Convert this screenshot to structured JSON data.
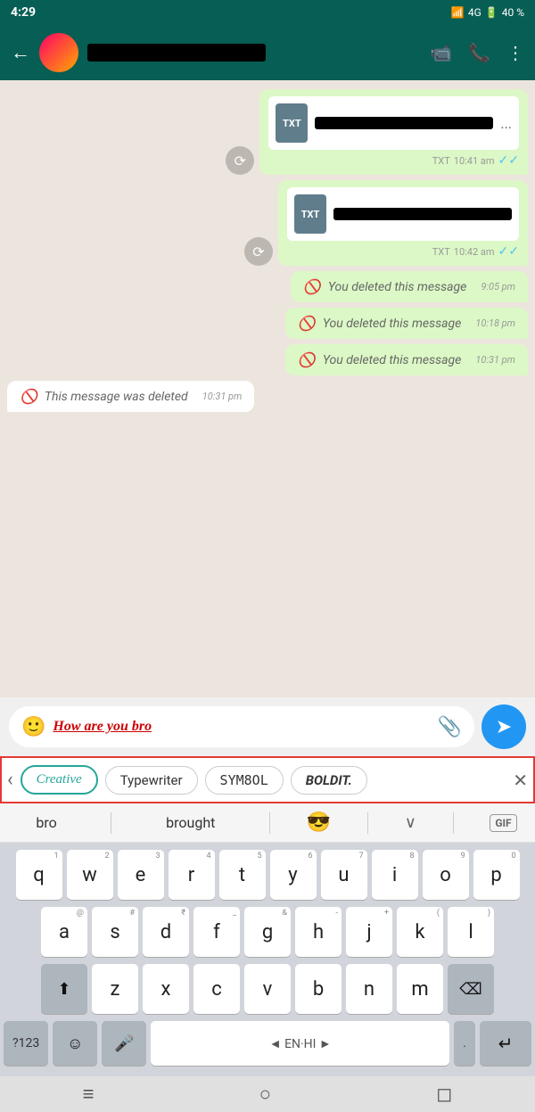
{
  "status_bar": {
    "time": "4:29",
    "signal": "4G",
    "battery": "40 %"
  },
  "header": {
    "contact_name": "REDACTED",
    "back_label": "←",
    "video_icon": "📹",
    "call_icon": "📞",
    "more_icon": "⋮"
  },
  "messages": [
    {
      "id": "msg1",
      "type": "file_sent",
      "file_type": "TXT",
      "name_redacted": true,
      "has_dots": true,
      "time": "10:41 am",
      "has_forward": true
    },
    {
      "id": "msg2",
      "type": "file_sent",
      "file_type": "TXT",
      "name_redacted": true,
      "has_dots": false,
      "time": "10:42 am",
      "has_forward": true
    },
    {
      "id": "msg3",
      "type": "deleted_sent",
      "text": "You deleted this message",
      "time": "9:05 pm"
    },
    {
      "id": "msg4",
      "type": "deleted_sent",
      "text": "You deleted this message",
      "time": "10:18 pm"
    },
    {
      "id": "msg5",
      "type": "deleted_sent",
      "text": "You deleted this message",
      "time": "10:31 pm"
    },
    {
      "id": "msg6",
      "type": "deleted_received",
      "text": "This message was deleted",
      "time": "10:31 pm"
    }
  ],
  "input": {
    "emoji_icon": "🙂",
    "text": "How are you bro",
    "attach_icon": "📎",
    "send_icon": "➤"
  },
  "font_picker": {
    "arrow_left": "‹",
    "fonts": [
      {
        "label": "Creative",
        "active": true
      },
      {
        "label": "Typewriter",
        "active": false
      },
      {
        "label": "SYM8OL",
        "active": false
      },
      {
        "label": "BOLDIT.",
        "active": false
      }
    ],
    "close_icon": "✕"
  },
  "suggestions": {
    "words": [
      "bro",
      "brought"
    ],
    "emoji": "😎",
    "expand_icon": "∨",
    "gif_label": "GIF"
  },
  "keyboard": {
    "rows": [
      [
        "q",
        "w",
        "e",
        "r",
        "t",
        "y",
        "u",
        "i",
        "o",
        "p"
      ],
      [
        "a",
        "s",
        "d",
        "f",
        "g",
        "h",
        "j",
        "k",
        "l"
      ],
      [
        "z",
        "x",
        "c",
        "v",
        "b",
        "n",
        "m"
      ]
    ],
    "number_row": [
      "1",
      "2",
      "3",
      "4",
      "5",
      "6",
      "7",
      "8",
      "9",
      "0"
    ],
    "bottom_row": {
      "symbols": "?123",
      "emoji": "☺",
      "mic": "🎤",
      "space": "◄ EN·HI ►",
      "period": ".",
      "enter": "↵"
    }
  },
  "bottom_nav": {
    "items": [
      "≡",
      "○",
      "◻"
    ]
  },
  "colors": {
    "whatsapp_green": "#075e54",
    "chat_bg": "#ece5dd",
    "sent_bubble": "#dcf8c6",
    "received_bubble": "#ffffff",
    "highlight_red": "#e53935",
    "active_font": "#26a69a"
  }
}
